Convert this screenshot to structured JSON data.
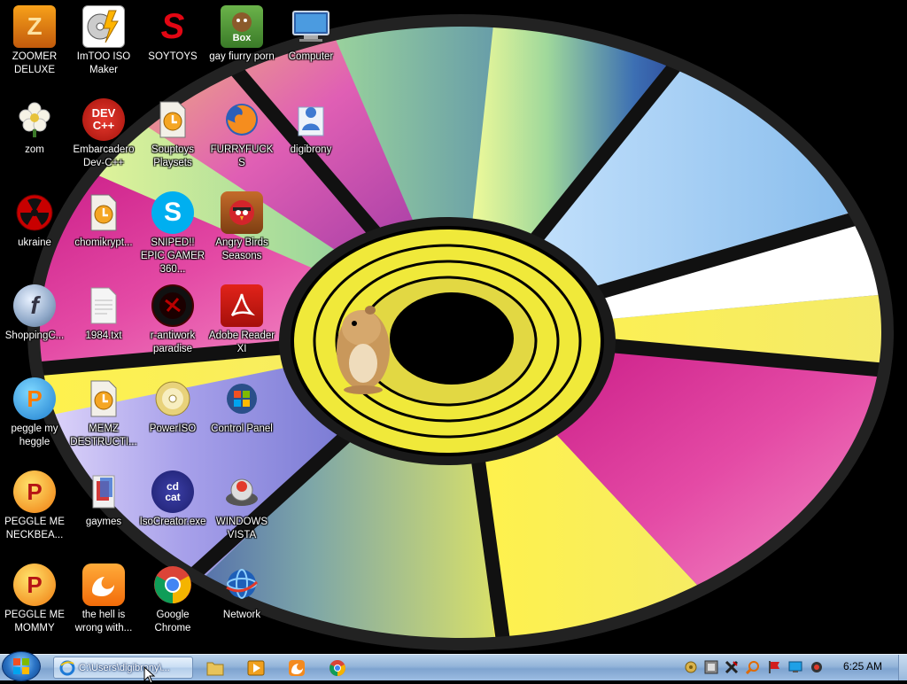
{
  "desktop": {
    "icons": [
      {
        "label": "ZOOMER DELUXE",
        "icon": "zoomer-icon"
      },
      {
        "label": "ImTOO ISO Maker",
        "icon": "iso-maker-icon"
      },
      {
        "label": "SOYTOYS",
        "icon": "soytoys-icon"
      },
      {
        "label": "gay fiurry porn",
        "icon": "box-game-icon"
      },
      {
        "label": "Computer",
        "icon": "computer-icon"
      },
      {
        "label": "zom",
        "icon": "flower-icon"
      },
      {
        "label": "Embarcadero Dev-C++",
        "icon": "devcpp-icon"
      },
      {
        "label": "Souptoys Playsets",
        "icon": "shortcut-clock-icon"
      },
      {
        "label": "FURRYFUCKS",
        "icon": "firefox-icon"
      },
      {
        "label": "digibrony",
        "icon": "user-folder-icon"
      },
      {
        "label": "ukraine",
        "icon": "radiation-icon"
      },
      {
        "label": "chomikrypt...",
        "icon": "shortcut-clock-icon"
      },
      {
        "label": "SNIPED!! EPIC GAMER 360...",
        "icon": "skype-icon"
      },
      {
        "label": "Angry Birds Seasons",
        "icon": "angry-birds-icon"
      },
      {
        "label": "ShoppingC...",
        "icon": "flash-icon"
      },
      {
        "label": "1984.txt",
        "icon": "text-file-icon"
      },
      {
        "label": "r-antiwork paradise",
        "icon": "antiwork-icon"
      },
      {
        "label": "Adobe Reader XI",
        "icon": "adobe-reader-icon"
      },
      {
        "label": "peggle my heggle",
        "icon": "peggle-icon"
      },
      {
        "label": "MEMZ DESTRUCTI...",
        "icon": "shortcut-clock-icon"
      },
      {
        "label": "PowerISO",
        "icon": "poweriso-icon"
      },
      {
        "label": "Control Panel",
        "icon": "control-panel-icon"
      },
      {
        "label": "PEGGLE ME NECKBEA...",
        "icon": "peggle-icon"
      },
      {
        "label": "gaymes",
        "icon": "games-folder-icon"
      },
      {
        "label": "IsoCreator.exe",
        "icon": "cdcat-icon"
      },
      {
        "label": "WINDOWS VISTA",
        "icon": "vista-icon"
      },
      {
        "label": "PEGGLE ME MOMMY",
        "icon": "peggle-icon"
      },
      {
        "label": "the hell is wrong with...",
        "icon": "uc-browser-icon"
      },
      {
        "label": "Google Chrome",
        "icon": "chrome-icon"
      },
      {
        "label": "Network",
        "icon": "network-icon"
      }
    ]
  },
  "taskbar": {
    "start_label": "Start",
    "active_window": "C:\\Users\\digibrony\\...",
    "pinned": [
      {
        "icon": "explorer-folder-icon"
      },
      {
        "icon": "media-player-icon"
      },
      {
        "icon": "uc-browser-icon"
      },
      {
        "icon": "chrome-icon"
      }
    ],
    "tray_icons": [
      "speaker-icon",
      "tray-app-icon",
      "tray-x-icon",
      "search-tray-icon",
      "flag-icon",
      "monitor-icon",
      "volume-icon"
    ],
    "clock": "6:25 AM"
  },
  "colors": {
    "taskbar": "#93b4d9",
    "wallpaper_bg": "#000000"
  }
}
